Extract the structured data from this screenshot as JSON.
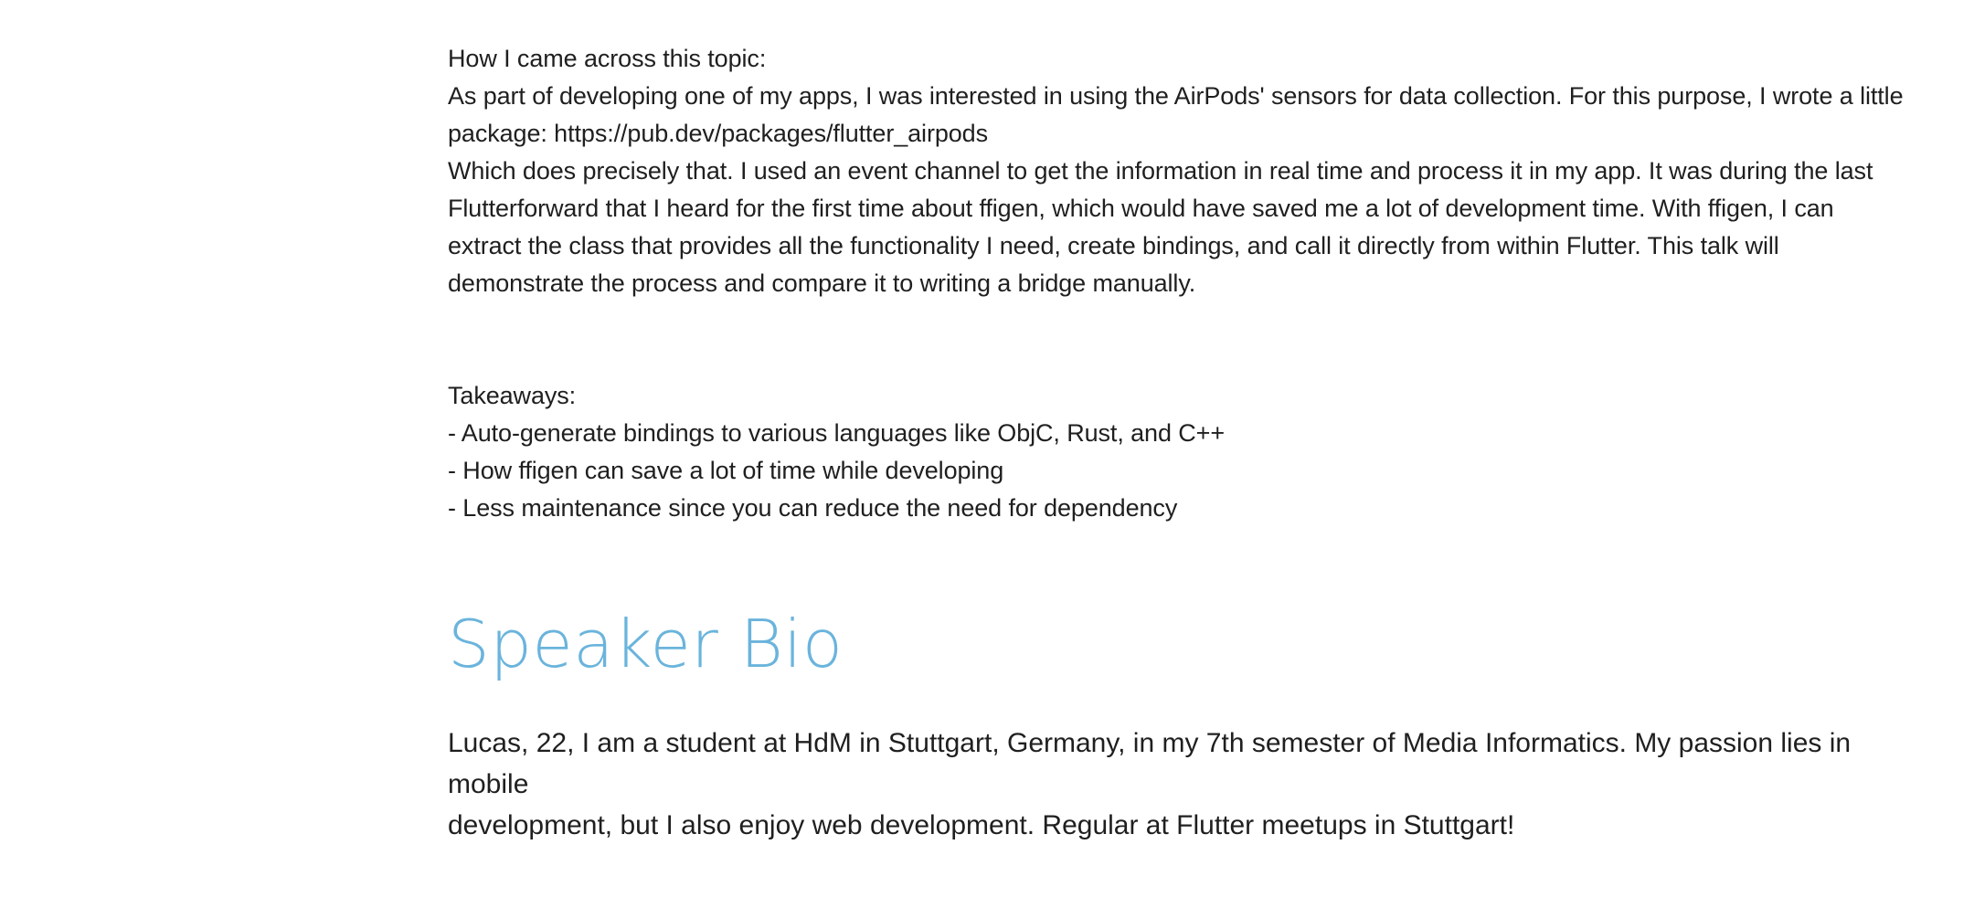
{
  "description": {
    "intro_heading": "How I came across this topic:",
    "intro_lines": [
      "As part of developing one of my apps, I was interested in using the AirPods' sensors for data collection. For this purpose, I wrote a little",
      "package: https://pub.dev/packages/flutter_airpods",
      "Which does precisely that. I used an event channel to get the information in real time and process it in my app. It was during the last",
      "Flutterforward that I heard for the first time about ffigen, which would have saved me a lot of development time. With ffigen, I can",
      "extract the class that provides all the functionality I need, create bindings, and call it directly from within Flutter. This talk will",
      "demonstrate the process and compare it to writing a bridge manually."
    ],
    "takeaways_heading": "Takeaways:",
    "takeaways": [
      "- Auto-generate bindings to various languages like ObjC, Rust, and C++",
      "- How ffigen can save a lot of time while developing",
      "- Less maintenance since you can reduce the need for dependency"
    ]
  },
  "speaker_bio": {
    "title": "Speaker Bio",
    "lines": [
      "Lucas, 22, I am a student at HdM in Stuttgart, Germany, in my 7th semester of Media Informatics. My passion lies in mobile",
      "development, but I also enjoy web development. Regular at Flutter meetups in Stuttgart!"
    ]
  },
  "colors": {
    "heading_accent": "#6ab4dc",
    "body_text": "#1f1f1f"
  }
}
